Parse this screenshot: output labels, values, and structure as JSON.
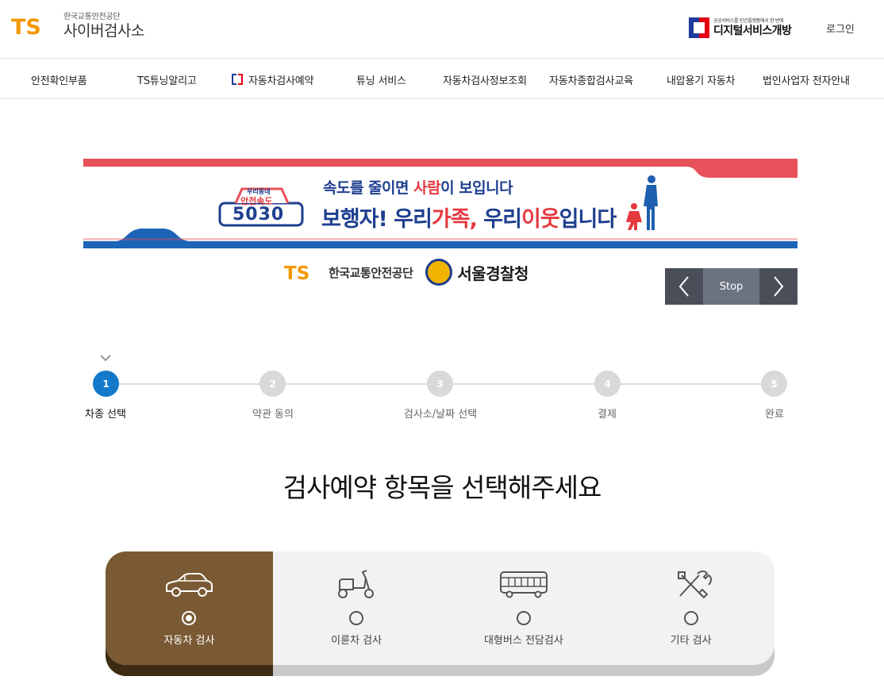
{
  "header": {
    "org_sub": "한국교통안전공단",
    "site_name": "사이버검사소",
    "logo_letters": "TS",
    "digital_sub": "공공서비스를 민간플랫폼에서 한 번에",
    "digital_name": "디지털서비스개방",
    "login_label": "로그인"
  },
  "gnb": {
    "items": [
      {
        "label": "안전확인부품"
      },
      {
        "label": "TS튜닝알리고"
      },
      {
        "label": "자동차검사예약"
      },
      {
        "label": "튜닝 서비스"
      },
      {
        "label": "자동차검사정보조회"
      },
      {
        "label": "자동차종합검사교육"
      },
      {
        "label": "내압용기 자동차"
      },
      {
        "label": "법인사업자 전자안내"
      }
    ]
  },
  "banner": {
    "badge_top": "우리동네",
    "badge_mid": "안전속도",
    "badge_num": "5030",
    "line1_a": "속도를 줄이면 ",
    "line1_b": "사람",
    "line1_c": "이 보입니다",
    "line2_a": "보행자! 우리",
    "line2_b": "가족, ",
    "line2_c": "우리",
    "line2_d": "이웃",
    "line2_e": "입니다",
    "partner1": "한국교통안전공단",
    "partner2": "서울경찰청",
    "stop_label": "Stop"
  },
  "steps": [
    {
      "num": "1",
      "label": "차종 선택",
      "active": true
    },
    {
      "num": "2",
      "label": "약관 동의",
      "active": false
    },
    {
      "num": "3",
      "label": "검사소/날짜 선택",
      "active": false
    },
    {
      "num": "4",
      "label": "결제",
      "active": false
    },
    {
      "num": "5",
      "label": "완료",
      "active": false
    }
  ],
  "main": {
    "title": "검사예약 항목을 선택해주세요"
  },
  "options": [
    {
      "label": "자동차 검사",
      "icon": "car-icon",
      "selected": true
    },
    {
      "label": "이륜차 검사",
      "icon": "scooter-icon",
      "selected": false
    },
    {
      "label": "대형버스 전담검사",
      "icon": "bus-icon",
      "selected": false
    },
    {
      "label": "기타 검사",
      "icon": "tools-icon",
      "selected": false
    }
  ],
  "colors": {
    "step_active": "#1479c9",
    "option_selected": "#7a5a34",
    "banner_red": "#e8505a",
    "banner_blue": "#1b64b6"
  }
}
